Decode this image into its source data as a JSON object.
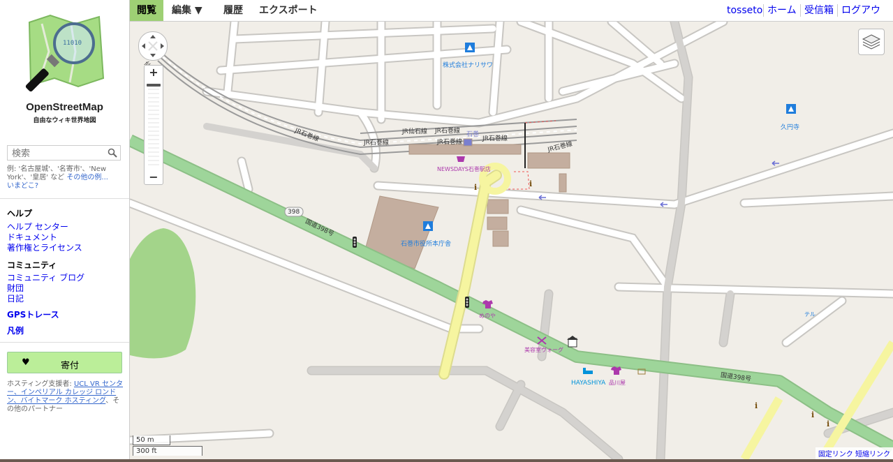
{
  "sidebar": {
    "brand_title": "OpenStreetMap",
    "brand_subtitle": "自由なウィキ世界地図",
    "search_placeholder": "検索",
    "hint_prefix": "例: '名古屋城'、'名寄市'、'New York'、'皇居' など",
    "hint_more_link": "その他の例...",
    "hint_where_link": "いまどこ?",
    "help_heading": "ヘルプ",
    "help_links": [
      "ヘルプ センター",
      "ドキュメント",
      "著作権とライセンス"
    ],
    "community_heading": "コミュニティ",
    "community_links": [
      "コミュニティ ブログ",
      "財団",
      "日記"
    ],
    "gps_traces": "GPSトレース",
    "legend": "凡例",
    "donate_label": "寄付",
    "hosting_prefix": "ホスティング支援者:",
    "hosting_links": "UCL VR センター、インペリアル カレッジ ロンドン、バイトマーク ホスティング",
    "hosting_suffix": "、その他のパートナー"
  },
  "topbar": {
    "tabs": [
      "閲覧",
      "編集 ▼",
      "履歴",
      "エクスポート"
    ],
    "active_tab": "閲覧",
    "user": "tosseto",
    "home": "ホーム",
    "inbox": "受信箱",
    "logout": "ログアウト"
  },
  "map": {
    "labels": {
      "rail_line_1": "JR仙石線",
      "rail_line_2": "JR石巻線",
      "station_label": "石巻",
      "company": "株式会社ナリサワ",
      "temple": "久円寺",
      "city_hall": "石巻市役所本庁舎",
      "newsdays": "NEWSDAYS石巻駅店",
      "route_shield": "398",
      "route_name": "国道398号",
      "shop_1": "めのや",
      "beauty": "美容室ヴォーグ",
      "hotel": "HAYASHIYA",
      "shop_2": "品川屋",
      "tel": "テル",
      "rail_cut": "仙石線"
    },
    "zoom_plus": "+",
    "zoom_minus": "−",
    "scale_metric": "50 m",
    "scale_imperial": "300 ft",
    "permalink": "固定リンク",
    "shortlink": "短縮リンク"
  },
  "colors": {
    "map_background": "#f1eee8",
    "primary_road": "#9ed59a",
    "secondary_road": "#f6f5a0",
    "minor_road": "#ffffff",
    "building": "#c4ae9f",
    "park": "#a3d48a",
    "active_tab": "#9ed074",
    "link": "#0000ee"
  }
}
